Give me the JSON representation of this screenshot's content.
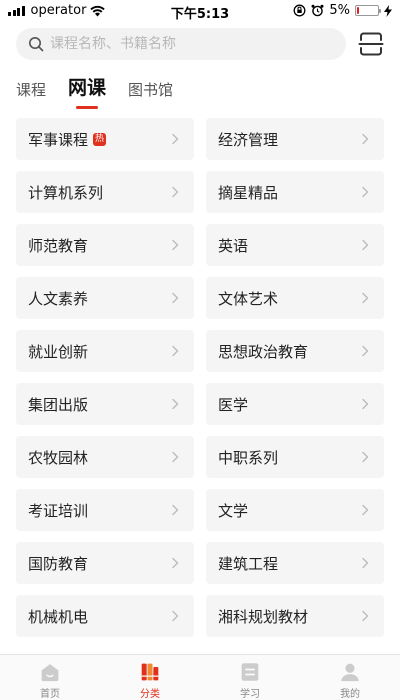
{
  "status_bar": {
    "carrier": "operator",
    "time": "下午5:13",
    "battery_percent": "5%",
    "battery_level": 0.05
  },
  "search": {
    "placeholder": "课程名称、书籍名称",
    "value": ""
  },
  "tabs": [
    {
      "label": "课程",
      "active": false
    },
    {
      "label": "网课",
      "active": true
    },
    {
      "label": "图书馆",
      "active": false
    }
  ],
  "categories": [
    {
      "label": "军事课程",
      "hot": "热"
    },
    {
      "label": "经济管理"
    },
    {
      "label": "计算机系列"
    },
    {
      "label": "摘星精品"
    },
    {
      "label": "师范教育"
    },
    {
      "label": "英语"
    },
    {
      "label": "人文素养"
    },
    {
      "label": "文体艺术"
    },
    {
      "label": "就业创新"
    },
    {
      "label": "思想政治教育"
    },
    {
      "label": "集团出版"
    },
    {
      "label": "医学"
    },
    {
      "label": "农牧园林"
    },
    {
      "label": "中职系列"
    },
    {
      "label": "考证培训"
    },
    {
      "label": "文学"
    },
    {
      "label": "国防教育"
    },
    {
      "label": "建筑工程"
    },
    {
      "label": "机械机电"
    },
    {
      "label": "湘科规划教材"
    }
  ],
  "bottom_nav": [
    {
      "label": "首页",
      "icon": "home-icon",
      "active": false
    },
    {
      "label": "分类",
      "icon": "category-icon",
      "active": true
    },
    {
      "label": "学习",
      "icon": "study-icon",
      "active": false
    },
    {
      "label": "我的",
      "icon": "profile-icon",
      "active": false
    }
  ],
  "colors": {
    "accent": "#e0301e",
    "cell_bg": "#f5f5f5",
    "inactive_icon": "#cccccc"
  }
}
